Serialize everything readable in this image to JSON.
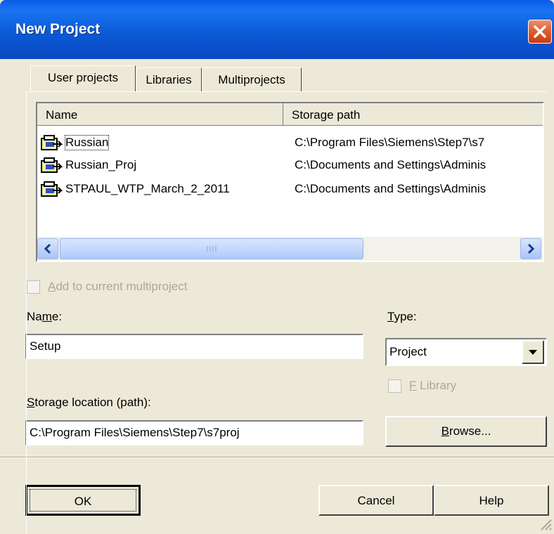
{
  "window": {
    "title": "New Project"
  },
  "tabs": [
    {
      "label": "User projects",
      "selected": true
    },
    {
      "label": "Libraries",
      "selected": false
    },
    {
      "label": "Multiprojects",
      "selected": false
    }
  ],
  "list": {
    "columns": [
      "Name",
      "Storage path"
    ],
    "rows": [
      {
        "name": "Russian",
        "path": "C:\\Program Files\\Siemens\\Step7\\s7",
        "icon": "project-icon",
        "selected": true
      },
      {
        "name": "Russian_Proj",
        "path": "C:\\Documents and Settings\\Adminis",
        "icon": "project-icon"
      },
      {
        "name": "STPAUL_WTP_March_2_2011",
        "path": "C:\\Documents and Settings\\Adminis",
        "icon": "project-icon"
      }
    ]
  },
  "add_to_multiproject": {
    "label_underlined": "A",
    "label_rest": "dd to current multiproject",
    "checked": false,
    "enabled": false
  },
  "name_field": {
    "label_pre": "Na",
    "label_underlined": "m",
    "label_post": "e:",
    "value": "Setup"
  },
  "type_field": {
    "label_underlined": "T",
    "label_rest": "ype:",
    "value": "Project"
  },
  "f_library": {
    "label_underlined": "F",
    "label_rest": " Library",
    "checked": false,
    "enabled": false
  },
  "storage_field": {
    "label_underlined": "S",
    "label_rest": "torage location (path):",
    "value": "C:\\Program Files\\Siemens\\Step7\\s7proj"
  },
  "buttons": {
    "browse_underlined": "B",
    "browse_rest": "rowse...",
    "ok": "OK",
    "cancel": "Cancel",
    "help": "Help"
  },
  "colors": {
    "titlebar": "#0a5ce8",
    "dialog_bg": "#ece9d8",
    "close": "#e05a2c"
  }
}
